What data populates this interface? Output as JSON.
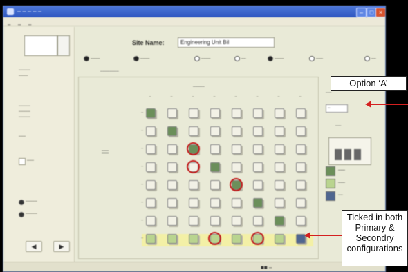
{
  "window": {
    "title": "– – – – –",
    "menu": [
      "–",
      "–",
      "–"
    ]
  },
  "site": {
    "label": "Site Name:",
    "value": "Engineering Unit Bil"
  },
  "grid": {
    "rows": 8,
    "cols": 8,
    "cells": [
      [
        "P",
        "N",
        "N",
        "N",
        "N",
        "N",
        "N",
        "N"
      ],
      [
        "N",
        "P",
        "N",
        "N",
        "N",
        "N",
        "N",
        "N"
      ],
      [
        "N",
        "N",
        "P",
        "N",
        "N",
        "N",
        "N",
        "N"
      ],
      [
        "N",
        "N",
        "N",
        "P",
        "N",
        "N",
        "N",
        "N"
      ],
      [
        "N",
        "N",
        "N",
        "N",
        "P",
        "N",
        "N",
        "N"
      ],
      [
        "N",
        "N",
        "N",
        "N",
        "N",
        "P",
        "N",
        "N"
      ],
      [
        "N",
        "N",
        "N",
        "N",
        "N",
        "N",
        "P",
        "N"
      ],
      [
        "S",
        "S",
        "S",
        "S",
        "S",
        "S",
        "S",
        "B"
      ]
    ],
    "circled": [
      [
        2,
        2
      ],
      [
        3,
        2
      ],
      [
        4,
        4
      ],
      [
        7,
        3
      ],
      [
        7,
        5
      ]
    ]
  },
  "colors": {
    "primary": "#6b8f5a",
    "secondary": "#b9d48f",
    "both": "#4f6690",
    "highlight": "#f3f0a6",
    "annotation": "#c41b1b"
  },
  "annotations": {
    "option_a": "Option ‘A’",
    "ticked_both": [
      "Ticked in both",
      "Primary &",
      "Secondry",
      "configurations"
    ]
  },
  "icons": {
    "minimize": "minimize-icon",
    "maximize": "maximize-icon",
    "close": "close-icon"
  }
}
